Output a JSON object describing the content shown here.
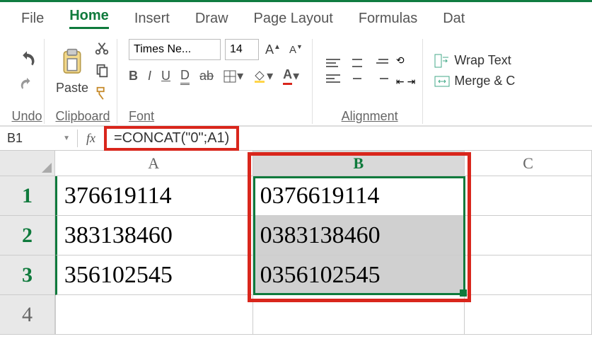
{
  "tabs": {
    "file": "File",
    "home": "Home",
    "insert": "Insert",
    "draw": "Draw",
    "page_layout": "Page Layout",
    "formulas": "Formulas",
    "data": "Dat"
  },
  "ribbon": {
    "undo_label": "Undo",
    "clipboard_label": "Clipboard",
    "paste_label": "Paste",
    "font_label": "Font",
    "font_name": "Times Ne...",
    "font_size": "14",
    "alignment_label": "Alignment",
    "wrap_text": "Wrap Text",
    "merge_center": "Merge & C"
  },
  "formula_bar": {
    "cell_ref": "B1",
    "fx": "fx",
    "formula": "=CONCAT(\"0\";A1)"
  },
  "columns": {
    "A": "A",
    "B": "B",
    "C": "C"
  },
  "rows": {
    "r1": {
      "num": "1",
      "A": "376619114",
      "B": "0376619114"
    },
    "r2": {
      "num": "2",
      "A": "383138460",
      "B": "0383138460"
    },
    "r3": {
      "num": "3",
      "A": "356102545",
      "B": "0356102545"
    },
    "r4": {
      "num": "4"
    }
  },
  "chart_data": {
    "type": "table",
    "columns": [
      "A",
      "B"
    ],
    "rows": [
      [
        "376619114",
        "0376619114"
      ],
      [
        "383138460",
        "0383138460"
      ],
      [
        "356102545",
        "0356102545"
      ]
    ],
    "formula_B": "=CONCAT(\"0\";A1)"
  }
}
